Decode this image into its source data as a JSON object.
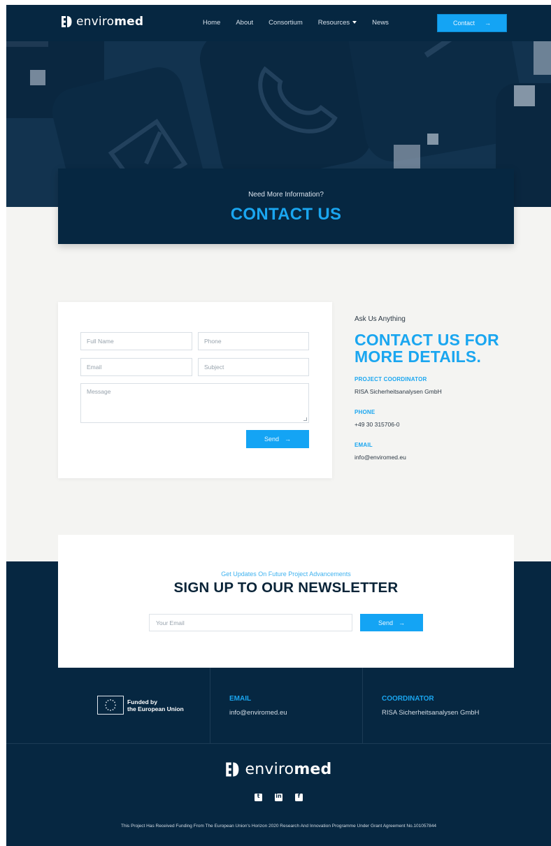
{
  "brand": {
    "logo_prefix": "enviro",
    "logo_suffix": "med"
  },
  "nav": {
    "links": [
      "Home",
      "About",
      "Consortium",
      "Resources",
      "News"
    ],
    "cta_label": "Contact",
    "cta_arrow": "→"
  },
  "hero": {
    "kicker": "Need More Information?",
    "title": "CONTACT US"
  },
  "form": {
    "full_name_placeholder": "Full Name",
    "phone_placeholder": "Phone",
    "email_placeholder": "Email",
    "subject_placeholder": "Subject",
    "message_placeholder": "Message",
    "send_label": "Send",
    "send_arrow": "→"
  },
  "contact_info": {
    "kicker": "Ask Us Anything",
    "title_line1": "CONTACT US FOR",
    "title_line2": "MORE DETAILS.",
    "items": [
      {
        "label": "PROJECT COORDINATOR",
        "value": "RISA Sicherheitsanalysen GmbH"
      },
      {
        "label": "PHONE",
        "value": "+49 30 315706-0"
      },
      {
        "label": "EMAIL",
        "value": "info@enviromed.eu"
      }
    ]
  },
  "newsletter": {
    "kicker": "Get Updates On Future Project Advancements",
    "title": "SIGN UP TO OUR NEWSLETTER",
    "email_placeholder": "Your Email",
    "send_label": "Send",
    "send_arrow": "→"
  },
  "footer": {
    "eu_line1": "Funded by",
    "eu_line2": "the European Union",
    "email_label": "EMAIL",
    "email_value": "info@enviromed.eu",
    "coordinator_label": "COORDINATOR",
    "coordinator_value": "RISA Sicherheitsanalysen GmbH",
    "social_icons": [
      "twitter-icon",
      "linkedin-icon",
      "facebook-icon"
    ],
    "legal": "This Project Has Received Funding From The European Union's Horizon 2020 Research And Innovation Programme Under Grant Agreement No.101057844"
  },
  "colors": {
    "navy": "#062741",
    "accent": "#1aa6f0",
    "background": "#f4f4f2"
  }
}
